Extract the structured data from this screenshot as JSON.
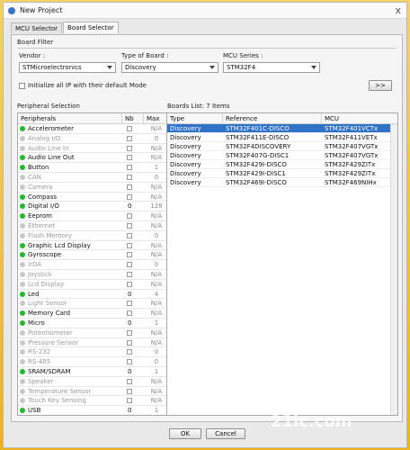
{
  "window": {
    "title": "New Project",
    "close_icon": "x"
  },
  "tabs": [
    {
      "label": "MCU Selector"
    },
    {
      "label": "Board Selector"
    }
  ],
  "board_filter": {
    "title": "Board Filter",
    "vendor_label": "Vendor :",
    "vendor_value": "STMicroelectronics",
    "type_label": "Type of Board :",
    "type_value": "Discovery",
    "series_label": "MCU Series :",
    "series_value": "STM32F4",
    "init_label": "Initialize all IP with their default Mode",
    "more_button": ">>"
  },
  "peripheral_section": {
    "title": "Peripheral Selection",
    "headers": [
      "Peripherals",
      "Nb",
      "Max"
    ],
    "rows": [
      {
        "name": "Accelerometer",
        "max": "N/A",
        "enabled": true
      },
      {
        "name": "Analog I/O",
        "max": "0",
        "enabled": false
      },
      {
        "name": "Audio Line In",
        "max": "N/A",
        "enabled": false
      },
      {
        "name": "Audio Line Out",
        "max": "N/A",
        "enabled": true
      },
      {
        "name": "Button",
        "max": "1",
        "enabled": true
      },
      {
        "name": "CAN",
        "max": "0",
        "enabled": false
      },
      {
        "name": "Camera",
        "max": "N/A",
        "enabled": false
      },
      {
        "name": "Compass",
        "max": "N/A",
        "enabled": true
      },
      {
        "name": "Digital I/O",
        "max": "128",
        "enabled": true,
        "nb": "0"
      },
      {
        "name": "Eeprom",
        "max": "N/A",
        "enabled": true
      },
      {
        "name": "Ethernet",
        "max": "N/A",
        "enabled": false
      },
      {
        "name": "Flash Memory",
        "max": "0",
        "enabled": false
      },
      {
        "name": "Graphic Lcd Display",
        "max": "N/A",
        "enabled": true
      },
      {
        "name": "Gyroscope",
        "max": "N/A",
        "enabled": true
      },
      {
        "name": "IrDA",
        "max": "0",
        "enabled": false
      },
      {
        "name": "Joystick",
        "max": "N/A",
        "enabled": false
      },
      {
        "name": "Lcd Display",
        "max": "N/A",
        "enabled": false
      },
      {
        "name": "Led",
        "max": "4",
        "enabled": true,
        "nb": "0"
      },
      {
        "name": "Light Sensor",
        "max": "N/A",
        "enabled": false
      },
      {
        "name": "Memory Card",
        "max": "N/A",
        "enabled": true
      },
      {
        "name": "Micro",
        "max": "1",
        "enabled": true,
        "nb": "0"
      },
      {
        "name": "Potentiometer",
        "max": "N/A",
        "enabled": false
      },
      {
        "name": "Pressure Sensor",
        "max": "N/A",
        "enabled": false
      },
      {
        "name": "RS-232",
        "max": "0",
        "enabled": false
      },
      {
        "name": "RS-485",
        "max": "0",
        "enabled": false
      },
      {
        "name": "SRAM/SDRAM",
        "max": "1",
        "enabled": true,
        "nb": "0"
      },
      {
        "name": "Speaker",
        "max": "N/A",
        "enabled": false
      },
      {
        "name": "Temperature Sensor",
        "max": "N/A",
        "enabled": false
      },
      {
        "name": "Touch Key Sensing",
        "max": "N/A",
        "enabled": false
      },
      {
        "name": "USB",
        "max": "1",
        "enabled": true,
        "nb": "0"
      }
    ]
  },
  "boards_section": {
    "title": "Boards List: 7 Items",
    "headers": [
      "Type",
      "Reference",
      "MCU"
    ],
    "rows": [
      {
        "type": "Discovery",
        "reference": "STM32F401C-DISCO",
        "mcu": "STM32F401VCTx",
        "selected": true
      },
      {
        "type": "Discovery",
        "reference": "STM32F411E-DISCO",
        "mcu": "STM32F411VETx",
        "selected": false
      },
      {
        "type": "Discovery",
        "reference": "STM32F4DISCOVERY",
        "mcu": "STM32F407VGTx",
        "selected": false
      },
      {
        "type": "Discovery",
        "reference": "STM32F407G-DISC1",
        "mcu": "STM32F407VGTx",
        "selected": false
      },
      {
        "type": "Discovery",
        "reference": "STM32F429I-DISCO",
        "mcu": "STM32F429ZITx",
        "selected": false
      },
      {
        "type": "Discovery",
        "reference": "STM32F429I-DISC1",
        "mcu": "STM32F429ZITx",
        "selected": false
      },
      {
        "type": "Discovery",
        "reference": "STM32F469I-DISCO",
        "mcu": "STM32F469NIHx",
        "selected": false
      }
    ]
  },
  "buttons": {
    "ok": "OK",
    "cancel": "Cancel"
  },
  "watermark": "21ic.com"
}
